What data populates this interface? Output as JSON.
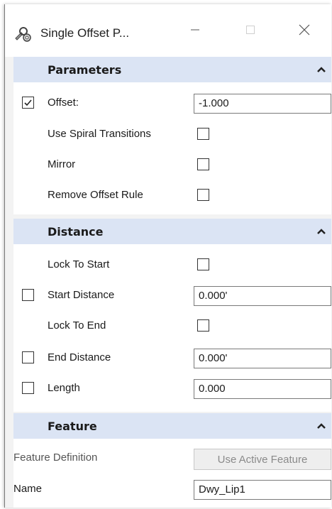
{
  "window": {
    "title": "Single Offset P...",
    "app_icon": "wrench-gear-icon",
    "controls": {
      "minimize_icon": "minimize-icon",
      "maximize_icon": "maximize-icon",
      "close_icon": "close-icon"
    }
  },
  "colors": {
    "section_header_bg": "#dbe4f4",
    "panel_bg": "#f3f3f3",
    "disabled_text": "#8a8a8a"
  },
  "parameters": {
    "title": "Parameters",
    "collapse_icon": "chevron-up-icon",
    "offset": {
      "label": "Offset:",
      "value": "-1.000",
      "checked": true
    },
    "use_spiral_transitions": {
      "label": "Use Spiral Transitions",
      "checked": false
    },
    "mirror": {
      "label": "Mirror",
      "checked": false
    },
    "remove_offset_rule": {
      "label": "Remove Offset Rule",
      "checked": false
    }
  },
  "distance": {
    "title": "Distance",
    "collapse_icon": "chevron-up-icon",
    "lock_to_start": {
      "label": "Lock To Start",
      "checked": false
    },
    "start_distance": {
      "label": "Start Distance",
      "value": "0.000'",
      "checked": false
    },
    "lock_to_end": {
      "label": "Lock To End",
      "checked": false
    },
    "end_distance": {
      "label": "End Distance",
      "value": "0.000'",
      "checked": false
    },
    "length": {
      "label": "Length",
      "value": "0.000",
      "checked": false
    }
  },
  "feature": {
    "title": "Feature",
    "collapse_icon": "chevron-up-icon",
    "feature_definition": {
      "label": "Feature Definition",
      "button_label": "Use Active Feature"
    },
    "name": {
      "label": "Name",
      "value": "Dwy_Lip1"
    }
  }
}
